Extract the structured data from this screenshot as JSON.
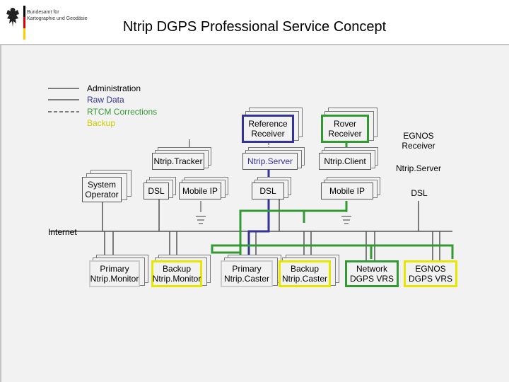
{
  "header": {
    "org_line1": "Bundesamt für",
    "org_line2": "Kartographie und Geodäsie",
    "title": "Ntrip DGPS Professional Service Concept"
  },
  "legend": [
    {
      "label": "Administration",
      "color": "#000000",
      "style": "solid"
    },
    {
      "label": "Raw Data",
      "color": "#333399",
      "style": "solid"
    },
    {
      "label": "RTCM Corrections",
      "color": "#339933",
      "style": "dashed"
    },
    {
      "label": "Backup",
      "color": "#cccc00",
      "style": "solid"
    }
  ],
  "nodes": {
    "system_operator": "System Operator",
    "dsl_tracker": "DSL",
    "mobile_ip_tracker": "Mobile IP",
    "ntrip_tracker": "Ntrip.Tracker",
    "reference_receiver": "Reference Receiver",
    "ntrip_server_center": "Ntrip.Server",
    "dsl_center": "DSL",
    "rover_receiver": "Rover Receiver",
    "ntrip_client": "Ntrip.Client",
    "mobile_ip_client": "Mobile IP",
    "egnos_receiver": "EGNOS Receiver",
    "ntrip_server_right": "Ntrip.Server",
    "dsl_right": "DSL",
    "internet": "Internet",
    "primary_monitor": "Primary Ntrip.Monitor",
    "backup_monitor": "Backup Ntrip.Monitor",
    "primary_caster": "Primary Ntrip.Caster",
    "backup_caster": "Backup Ntrip.Caster",
    "network_vrs": "Network DGPS VRS",
    "egnos_vrs": "EGNOS DGPS VRS"
  },
  "colors": {
    "blue": "#333399",
    "green": "#339933",
    "yellow": "#e6e600",
    "line": "#555555",
    "panel": "#f2f2f2",
    "frame": "#c4c4c4"
  }
}
